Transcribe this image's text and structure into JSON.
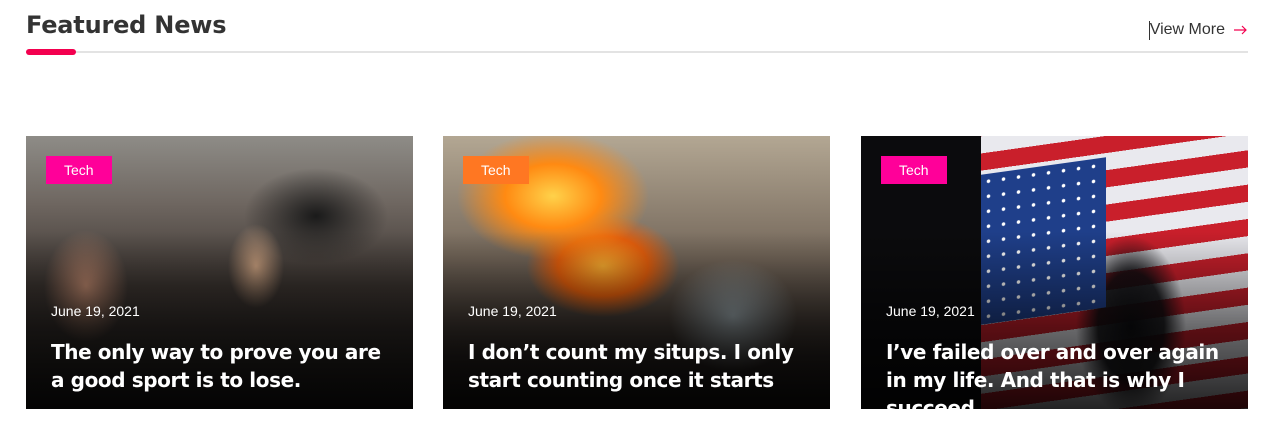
{
  "section": {
    "title": "Featured News",
    "view_more_label": "View More",
    "accent_color": "#f3004f"
  },
  "cards": [
    {
      "category": "Tech",
      "category_color": "#ff0099",
      "date": "June 19, 2021",
      "headline": "The only way to prove you are a good sport is to lose."
    },
    {
      "category": "Tech",
      "category_color": "#ff7722",
      "date": "June 19, 2021",
      "headline": "I don’t count my situps. I only start counting once it starts"
    },
    {
      "category": "Tech",
      "category_color": "#ff0099",
      "date": "June 19, 2021",
      "headline": "I’ve failed over and over again in my life. And that is why I succeed."
    }
  ]
}
